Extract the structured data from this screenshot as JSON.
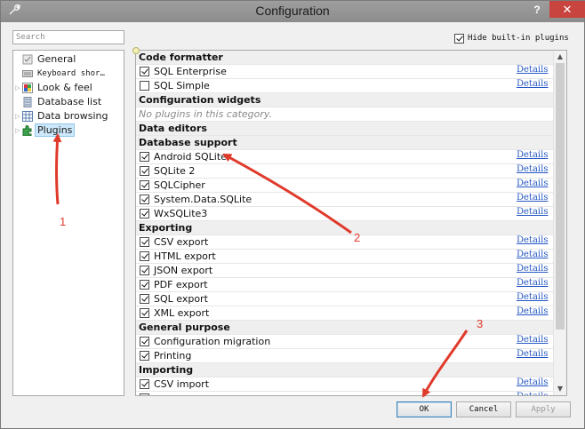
{
  "window": {
    "title": "Configuration",
    "help": "?",
    "close": "✕"
  },
  "search": {
    "placeholder": "Search"
  },
  "hide_builtin": {
    "label": "Hide built-in plugins",
    "checked": true
  },
  "tree": [
    {
      "label": "General",
      "icon": "checkbox-icon",
      "expandable": false,
      "mono": false,
      "selected": false
    },
    {
      "label": "Keyboard shor…",
      "icon": "keyboard-icon",
      "expandable": false,
      "mono": true,
      "selected": false
    },
    {
      "label": "Look & feel",
      "icon": "palette-icon",
      "expandable": true,
      "mono": false,
      "selected": false
    },
    {
      "label": "Database list",
      "icon": "database-icon",
      "expandable": false,
      "mono": false,
      "selected": false
    },
    {
      "label": "Data browsing",
      "icon": "table-icon",
      "expandable": true,
      "mono": false,
      "selected": false
    },
    {
      "label": "Plugins",
      "icon": "puzzle-icon",
      "expandable": true,
      "mono": false,
      "selected": true
    }
  ],
  "plugin_rows": [
    {
      "type": "category",
      "label": "Code formatter"
    },
    {
      "type": "plugin",
      "label": "SQL Enterprise",
      "checked": true,
      "details": "Details"
    },
    {
      "type": "plugin",
      "label": "SQL Simple",
      "checked": false,
      "details": "Details"
    },
    {
      "type": "category",
      "label": "Configuration widgets"
    },
    {
      "type": "note",
      "label": "No plugins in this category."
    },
    {
      "type": "category",
      "label": "Data editors"
    },
    {
      "type": "category",
      "label": "Database support"
    },
    {
      "type": "plugin",
      "label": "Android SQLite",
      "checked": true,
      "details": "Details"
    },
    {
      "type": "plugin",
      "label": "SQLite 2",
      "checked": true,
      "details": "Details"
    },
    {
      "type": "plugin",
      "label": "SQLCipher",
      "checked": true,
      "details": "Details"
    },
    {
      "type": "plugin",
      "label": "System.Data.SQLite",
      "checked": true,
      "details": "Details"
    },
    {
      "type": "plugin",
      "label": "WxSQLite3",
      "checked": true,
      "details": "Details"
    },
    {
      "type": "category",
      "label": "Exporting"
    },
    {
      "type": "plugin",
      "label": "CSV export",
      "checked": true,
      "details": "Details"
    },
    {
      "type": "plugin",
      "label": "HTML export",
      "checked": true,
      "details": "Details"
    },
    {
      "type": "plugin",
      "label": "JSON export",
      "checked": true,
      "details": "Details"
    },
    {
      "type": "plugin",
      "label": "PDF export",
      "checked": true,
      "details": "Details"
    },
    {
      "type": "plugin",
      "label": "SQL export",
      "checked": true,
      "details": "Details"
    },
    {
      "type": "plugin",
      "label": "XML export",
      "checked": true,
      "details": "Details"
    },
    {
      "type": "category",
      "label": "General purpose"
    },
    {
      "type": "plugin",
      "label": "Configuration migration",
      "checked": true,
      "details": "Details"
    },
    {
      "type": "plugin",
      "label": "Printing",
      "checked": true,
      "details": "Details"
    },
    {
      "type": "category",
      "label": "Importing"
    },
    {
      "type": "plugin",
      "label": "CSV import",
      "checked": true,
      "details": "Details"
    },
    {
      "type": "plugin",
      "label": "",
      "checked": true,
      "details": "Details"
    }
  ],
  "buttons": {
    "ok": "OK",
    "cancel": "Cancel",
    "apply": "Apply"
  },
  "annotations": [
    {
      "label": "1",
      "color": "#e03a2b"
    },
    {
      "label": "2",
      "color": "#e03a2b"
    },
    {
      "label": "3",
      "color": "#e03a2b"
    }
  ]
}
